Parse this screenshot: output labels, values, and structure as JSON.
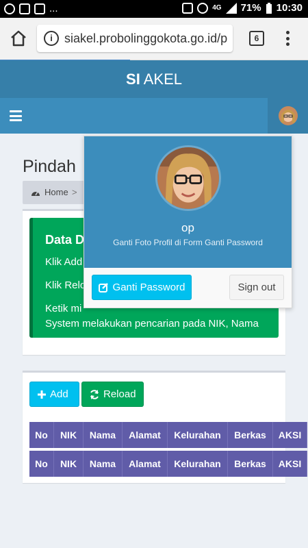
{
  "statusbar": {
    "battery": "71%",
    "time": "10:30",
    "network": "4G",
    "left_extra": "..."
  },
  "browser": {
    "url": "siakel.probolinggokota.go.id/p",
    "tab_count": "6"
  },
  "app": {
    "logo_bold": "SI",
    "logo_rest": "AKEL"
  },
  "page": {
    "title": "Pindah",
    "breadcrumb_home": "Home",
    "breadcrumb_sep": ">"
  },
  "callout": {
    "heading": "Data D",
    "line1": "Klik Add",
    "line2": "Klik Relo",
    "line3": "Ketik mi",
    "line4": "System melakukan pencarian pada NIK, Nama"
  },
  "buttons": {
    "add": "Add",
    "reload": "Reload"
  },
  "table": {
    "headers": [
      "No",
      "NIK",
      "Nama",
      "Alamat",
      "Kelurahan",
      "Berkas",
      "AKSI"
    ],
    "footers": [
      "No",
      "NIK",
      "Nama",
      "Alamat",
      "Kelurahan",
      "Berkas",
      "AKSI"
    ]
  },
  "user_menu": {
    "name": "op",
    "note": "Ganti Foto Profil di Form Ganti Password",
    "change_password": "Ganti Password",
    "sign_out": "Sign out"
  },
  "colors": {
    "header_dark": "#367fa9",
    "header": "#3c8dbc",
    "success": "#00a65a",
    "info": "#00c0ef",
    "purple": "#605ca8"
  }
}
